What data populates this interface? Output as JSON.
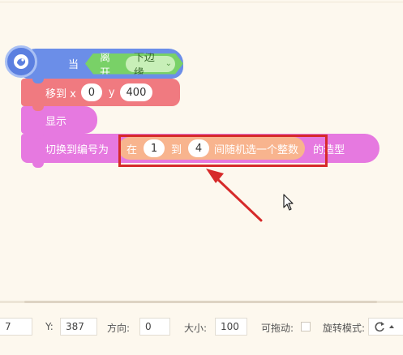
{
  "blocks": {
    "hat": {
      "label": "当",
      "condition": "离开",
      "edge_option": "下边缘",
      "color": "#6b8ee8"
    },
    "move": {
      "label": "移到 x",
      "x_value": "0",
      "y_label": "y",
      "y_value": "400",
      "color": "#f07a80"
    },
    "show": {
      "label": "显示",
      "color": "#e679e0"
    },
    "switch_costume": {
      "label": "切换到编号为",
      "suffix": "的造型",
      "color": "#e679e0",
      "random": {
        "prefix": "在",
        "from": "1",
        "to_label": "到",
        "to": "4",
        "suffix": "间随机选一个整数",
        "color": "#f8b48e"
      }
    }
  },
  "annotation": {
    "highlight_color": "#d62a2a"
  },
  "sprite_info": {
    "x_value": "7",
    "y_label": "Y:",
    "y_value": "387",
    "direction_label": "方向:",
    "direction_value": "0",
    "size_label": "大小:",
    "size_value": "100",
    "draggable_label": "可拖动:",
    "rotation_label": "旋转模式:"
  },
  "icons": {
    "hat_icon": "sprite-mascot-icon",
    "dropdown_icon": "chevron-down-icon",
    "rotation_icon": "rotate-all-around-icon",
    "cursor": "mouse-pointer-icon"
  }
}
